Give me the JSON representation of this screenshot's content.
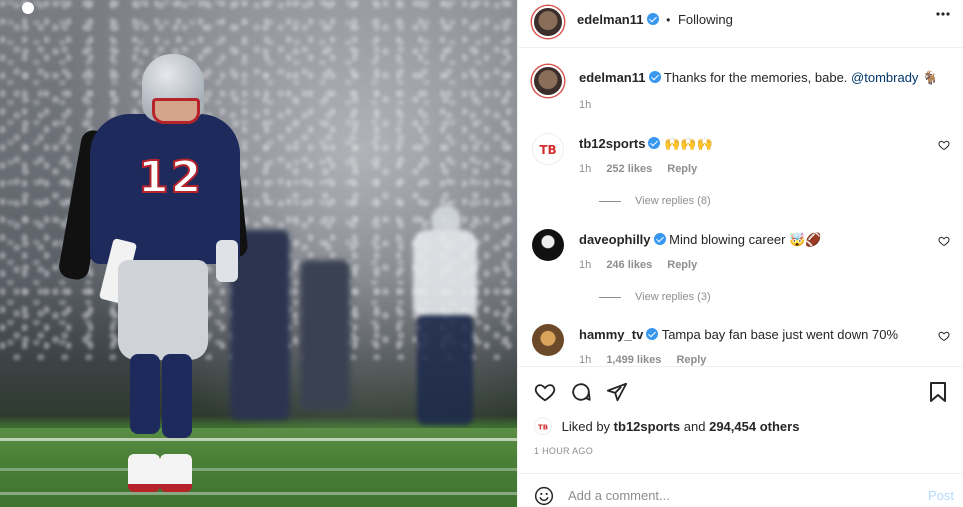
{
  "post": {
    "username": "edelman11",
    "following_label": "Following",
    "separator": "•",
    "more_label": "•••"
  },
  "caption": {
    "username": "edelman11",
    "text": "Thanks for the memories, babe.",
    "mention": "@tombrady",
    "emoji": "🐐",
    "time": "1h"
  },
  "comments": [
    {
      "username": "tb12sports",
      "text": "🙌🙌🙌",
      "time": "1h",
      "likes": "252 likes",
      "reply": "Reply",
      "view_replies": "View replies (8)"
    },
    {
      "username": "daveophilly",
      "text": "Mind blowing career 🤯🏈",
      "time": "1h",
      "likes": "246 likes",
      "reply": "Reply",
      "view_replies": "View replies (3)"
    },
    {
      "username": "hammy_tv",
      "text": "Tampa bay fan base just went down 70%",
      "time": "1h",
      "likes": "1,499 likes",
      "reply": "Reply"
    }
  ],
  "liked_by": {
    "prefix": "Liked by",
    "user": "tb12sports",
    "connector": "and",
    "count": "294,454 others"
  },
  "timestamp": "1 HOUR AGO",
  "add_comment": {
    "placeholder": "Add a comment...",
    "post_label": "Post"
  },
  "photo": {
    "jersey_number": "12"
  },
  "colors": {
    "verified": "#3897f0",
    "link": "#00376b",
    "muted": "#8e8e8e",
    "post_disabled": "#b3dbff"
  }
}
